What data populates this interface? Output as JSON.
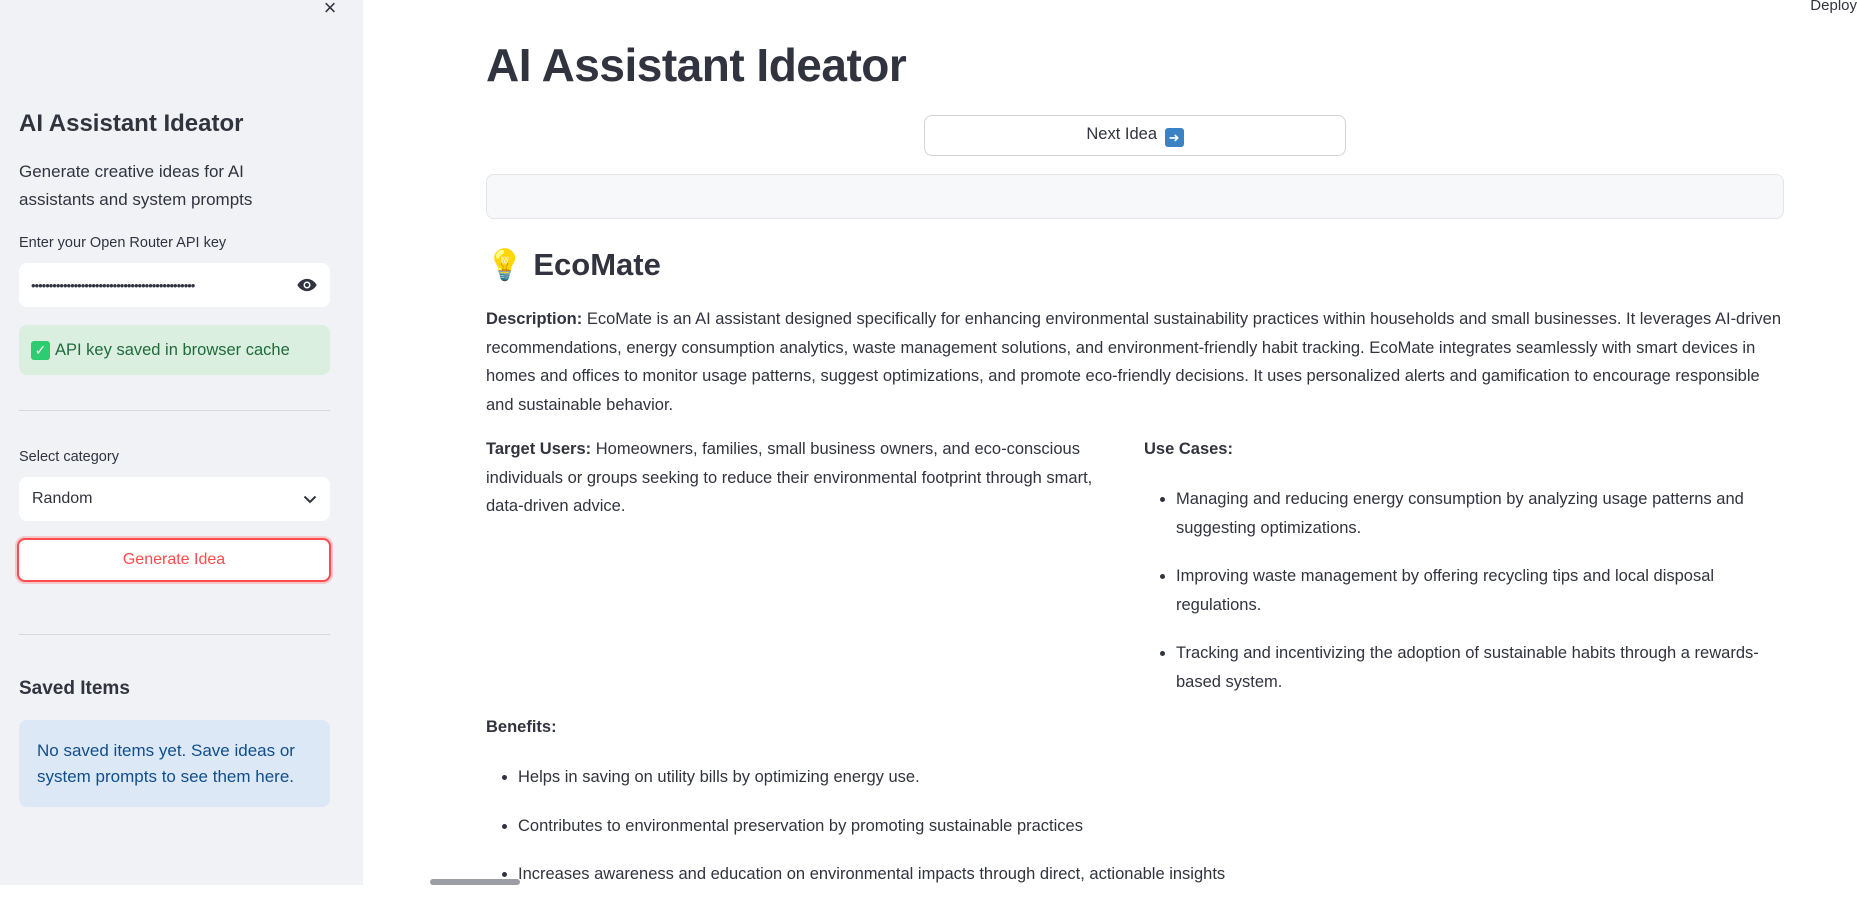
{
  "sidebar": {
    "close_glyph": "×",
    "title": "AI Assistant Ideator",
    "description": "Generate creative ideas for AI assistants and system prompts",
    "api_key_label": "Enter your Open Router API key",
    "api_key_value": "••••••••••••••••••••••••••••••••••••••••••••••",
    "api_saved_message": "API key saved in browser cache",
    "category_label": "Select category",
    "category_value": "Random",
    "generate_label": "Generate Idea",
    "saved_title": "Saved Items",
    "saved_empty": "No saved items yet. Save ideas or system prompts to see them here."
  },
  "header": {
    "deploy_label": "Deploy"
  },
  "main": {
    "title": "AI Assistant Ideator",
    "next_label": "Next Idea",
    "idea": {
      "name": "EcoMate",
      "description_label": "Description:",
      "description": "EcoMate is an AI assistant designed specifically for enhancing environmental sustainability practices within households and small businesses. It leverages AI-driven recommendations, energy consumption analytics, waste management solutions, and environment-friendly habit tracking. EcoMate integrates seamlessly with smart devices in homes and offices to monitor usage patterns, suggest optimizations, and promote eco-friendly decisions. It uses personalized alerts and gamification to encourage responsible and sustainable behavior.",
      "target_label": "Target Users:",
      "target": "Homeowners, families, small business owners, and eco-conscious individuals or groups seeking to reduce their environmental footprint through smart, data-driven advice.",
      "use_cases_label": "Use Cases:",
      "use_cases": [
        "Managing and reducing energy consumption by analyzing usage patterns and suggesting optimizations.",
        "Improving waste management by offering recycling tips and local disposal regulations.",
        "Tracking and incentivizing the adoption of sustainable habits through a rewards-based system."
      ],
      "benefits_label": "Benefits:",
      "benefits": [
        "Helps in saving on utility bills by optimizing energy use.",
        "Contributes to environmental preservation by promoting sustainable practices",
        "Increases awareness and education on environmental impacts through direct, actionable insights"
      ]
    }
  },
  "colors": {
    "sidebar_bg": "#f0f2f6",
    "accent": "#ff4b4b",
    "success_bg": "#dbefe1",
    "info_bg": "#dce8f6"
  },
  "icons": [
    "close-icon",
    "eye-icon",
    "check-icon",
    "chevron-down-icon",
    "arrow-right-icon",
    "lightbulb-icon"
  ]
}
